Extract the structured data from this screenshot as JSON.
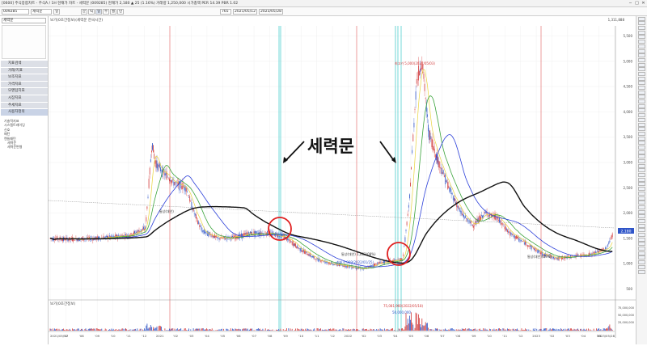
{
  "window": {
    "title": "[0600] 주식종합차트 - 주식A / 1H 현재가 차트 - 세력문 (009285) 현재가 2,180 ▲ 25 (1.16%) 거래량 1,250,000 시가총액 PER 14.39 PBR 1.02",
    "buttons": [
      "─",
      "□",
      "✕"
    ]
  },
  "toolbar": {
    "code": "009285",
    "name": "세력문",
    "period": "일",
    "units": [
      "분",
      "틱",
      "일",
      "주",
      "월",
      "년"
    ],
    "count": "765",
    "dates": [
      "2021/05/12",
      "2023/05/28"
    ]
  },
  "sidebar": {
    "search": "세력문",
    "menu": [
      "지표검색",
      "거래/지표",
      "보조지표",
      "가격지표",
      "모멘텀지표",
      "시장지표",
      "추세지표",
      "재무지표",
      "사용자정의"
    ],
    "tree": [
      "기술적지표",
      "시스템트레이딩",
      "신호",
      "패턴",
      "캔들패턴",
      "세력문",
      "세력문변형"
    ]
  },
  "chart": {
    "header": "보기(0초간정보)(세력문 한국시간)",
    "date_range": "2021/05/12 ~ 2023/05/28",
    "annotation": "세력문",
    "y_ticks": [
      "5,500",
      "5,000",
      "4,500",
      "4,000",
      "3,500",
      "3,000",
      "2,500",
      "2,000",
      "1,500",
      "1,000",
      "500"
    ],
    "current_price": "2,180",
    "top_right_value": "1,311,888",
    "max_label": "최고가 5,000(2022/05/03)",
    "min_label": "최저가 869(2022/01/25)",
    "low_label": "통상(대안) 1,082(08%)",
    "left_low_label": "통상(대안)",
    "right_low_label": "통상(대안)(09%)",
    "x_labels": [
      "2021/05/12",
      "'07",
      "'08",
      "'09",
      "'10",
      "'11",
      "'12",
      "2021",
      "'02",
      "'03",
      "'04",
      "'05",
      "'06",
      "'07",
      "'08",
      "'09",
      "'10",
      "'11",
      "'12",
      "2022",
      "'02",
      "'03",
      "'04",
      "'05",
      "'06",
      "'07",
      "'08",
      "'09",
      "'10",
      "'11",
      "'12",
      "2023",
      "'02",
      "'03",
      "'04",
      "'05",
      "2023/05/28"
    ],
    "volume_header": "보기(0초간정보)",
    "volume_max_label": "75,081,960(2022/05/18)",
    "volume_label2": "50,000,000",
    "volume_ticks": [
      "75,000,000",
      "50,000,000",
      "25,000,000"
    ],
    "colors": {
      "candle_up": "#d23a3a",
      "candle_down": "#2f55c8",
      "ma5": "#e8d43c",
      "ma20": "#3aa33a",
      "ma60": "#2b3fd9",
      "ma120": "#111111",
      "grid": "#ececec",
      "red_line": "#e05a5a",
      "cyan_line": "#38c8c8",
      "circle": "#e02020"
    }
  }
}
